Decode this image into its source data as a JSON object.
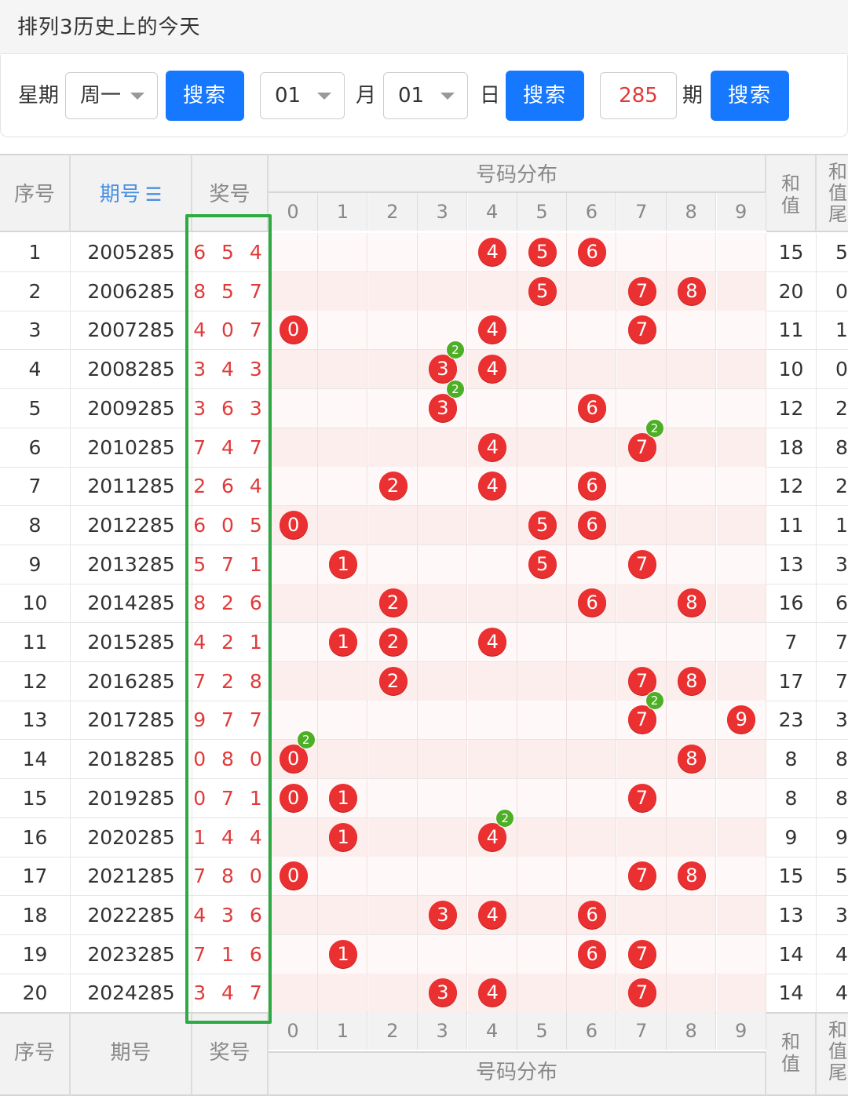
{
  "page_title": "排列3历史上的今天",
  "search": {
    "weekday_label": "星期",
    "weekday_value": "周一",
    "search_label": "搜索",
    "month_value": "01",
    "month_label": "月",
    "day_value": "01",
    "day_label": "日",
    "period_value": "285",
    "period_label": "期"
  },
  "table": {
    "headers": {
      "index": "序号",
      "period": "期号",
      "sort_icon": "sort-icon",
      "prize": "奖号",
      "distribution": "号码分布",
      "sum": "和值",
      "sum_tail": "和值尾"
    },
    "digits": [
      "0",
      "1",
      "2",
      "3",
      "4",
      "5",
      "6",
      "7",
      "8",
      "9"
    ],
    "rows": [
      {
        "idx": "1",
        "period": "2005285",
        "prize": "6 5 4",
        "d": [
          6,
          5,
          4
        ],
        "sum": "15",
        "tail": "5"
      },
      {
        "idx": "2",
        "period": "2006285",
        "prize": "8 5 7",
        "d": [
          8,
          5,
          7
        ],
        "sum": "20",
        "tail": "0"
      },
      {
        "idx": "3",
        "period": "2007285",
        "prize": "4 0 7",
        "d": [
          4,
          0,
          7
        ],
        "sum": "11",
        "tail": "1"
      },
      {
        "idx": "4",
        "period": "2008285",
        "prize": "3 4 3",
        "d": [
          3,
          4,
          3
        ],
        "sum": "10",
        "tail": "0"
      },
      {
        "idx": "5",
        "period": "2009285",
        "prize": "3 6 3",
        "d": [
          3,
          6,
          3
        ],
        "sum": "12",
        "tail": "2"
      },
      {
        "idx": "6",
        "period": "2010285",
        "prize": "7 4 7",
        "d": [
          7,
          4,
          7
        ],
        "sum": "18",
        "tail": "8"
      },
      {
        "idx": "7",
        "period": "2011285",
        "prize": "2 6 4",
        "d": [
          2,
          6,
          4
        ],
        "sum": "12",
        "tail": "2"
      },
      {
        "idx": "8",
        "period": "2012285",
        "prize": "6 0 5",
        "d": [
          6,
          0,
          5
        ],
        "sum": "11",
        "tail": "1"
      },
      {
        "idx": "9",
        "period": "2013285",
        "prize": "5 7 1",
        "d": [
          5,
          7,
          1
        ],
        "sum": "13",
        "tail": "3"
      },
      {
        "idx": "10",
        "period": "2014285",
        "prize": "8 2 6",
        "d": [
          8,
          2,
          6
        ],
        "sum": "16",
        "tail": "6"
      },
      {
        "idx": "11",
        "period": "2015285",
        "prize": "4 2 1",
        "d": [
          4,
          2,
          1
        ],
        "sum": "7",
        "tail": "7"
      },
      {
        "idx": "12",
        "period": "2016285",
        "prize": "7 2 8",
        "d": [
          7,
          2,
          8
        ],
        "sum": "17",
        "tail": "7"
      },
      {
        "idx": "13",
        "period": "2017285",
        "prize": "9 7 7",
        "d": [
          9,
          7,
          7
        ],
        "sum": "23",
        "tail": "3"
      },
      {
        "idx": "14",
        "period": "2018285",
        "prize": "0 8 0",
        "d": [
          0,
          8,
          0
        ],
        "sum": "8",
        "tail": "8"
      },
      {
        "idx": "15",
        "period": "2019285",
        "prize": "0 7 1",
        "d": [
          0,
          7,
          1
        ],
        "sum": "8",
        "tail": "8"
      },
      {
        "idx": "16",
        "period": "2020285",
        "prize": "1 4 4",
        "d": [
          1,
          4,
          4
        ],
        "sum": "9",
        "tail": "9"
      },
      {
        "idx": "17",
        "period": "2021285",
        "prize": "7 8 0",
        "d": [
          7,
          8,
          0
        ],
        "sum": "15",
        "tail": "5"
      },
      {
        "idx": "18",
        "period": "2022285",
        "prize": "4 3 6",
        "d": [
          4,
          3,
          6
        ],
        "sum": "13",
        "tail": "3"
      },
      {
        "idx": "19",
        "period": "2023285",
        "prize": "7 1 6",
        "d": [
          7,
          1,
          6
        ],
        "sum": "14",
        "tail": "4"
      },
      {
        "idx": "20",
        "period": "2024285",
        "prize": "3 4 7",
        "d": [
          3,
          4,
          7
        ],
        "sum": "14",
        "tail": "4"
      }
    ]
  },
  "colors": {
    "primary": "#1677ff",
    "ball": "#ea3030",
    "badge": "#4caf25",
    "highlight_box": "#2eaa42",
    "prize_text": "#e03a3a",
    "stripe": "#fdeeee"
  }
}
